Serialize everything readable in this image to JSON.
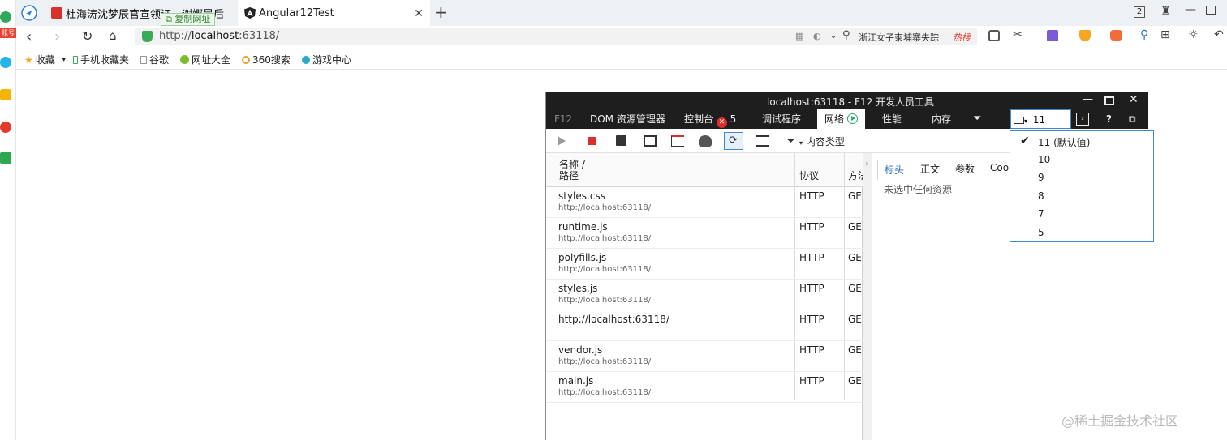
{
  "browser": {
    "tabs": [
      {
        "title": "杜海涛沈梦辰官宣领证，谢娜晨后"
      },
      {
        "title": "Angular12Test"
      }
    ],
    "copy_tooltip": "复制网址",
    "address": {
      "scheme": "http://",
      "host": "localhost",
      "rest": ":63118/"
    },
    "search_text": "浙江女子柬埔寨失踪",
    "hot_badge": "热搜",
    "tab_count": "2",
    "left_badge": "账号",
    "bookmarks": [
      "收藏",
      "手机收藏夹",
      "谷歌",
      "网址大全",
      "360搜索",
      "游戏中心"
    ]
  },
  "devtools": {
    "title": "localhost:63118 - F12 开发人员工具",
    "tabs": [
      "F12",
      "DOM 资源管理器",
      "控制台",
      "调试程序",
      "网络",
      "性能",
      "内存"
    ],
    "console_errors": "5",
    "emulation_mode": "11",
    "toolbar_filter_label": "内容类型",
    "grid_headers": {
      "name": "名称 /",
      "path": "路径",
      "protocol": "协议",
      "method": "方法"
    },
    "rows": [
      {
        "name": "styles.css",
        "url": "http://localhost:63118/",
        "protocol": "HTTP",
        "method": "GE"
      },
      {
        "name": "runtime.js",
        "url": "http://localhost:63118/",
        "protocol": "HTTP",
        "method": "GE"
      },
      {
        "name": "polyfills.js",
        "url": "http://localhost:63118/",
        "protocol": "HTTP",
        "method": "GE"
      },
      {
        "name": "styles.js",
        "url": "http://localhost:63118/",
        "protocol": "HTTP",
        "method": "GE"
      },
      {
        "name": "http://localhost:63118/",
        "url": "",
        "protocol": "HTTP",
        "method": "GE"
      },
      {
        "name": "vendor.js",
        "url": "http://localhost:63118/",
        "protocol": "HTTP",
        "method": "GE"
      },
      {
        "name": "main.js",
        "url": "http://localhost:63118/",
        "protocol": "HTTP",
        "method": "GE"
      }
    ],
    "detail_tabs": [
      "标头",
      "正文",
      "参数",
      "Cook"
    ],
    "detail_empty": "未选中任何资源"
  },
  "doc_mode_menu": {
    "items": [
      "11 (默认值)",
      "10",
      "9",
      "8",
      "7",
      "5"
    ],
    "selected_index": 0
  },
  "watermark": "@稀土掘金技术社区",
  "colors": {
    "accent": "#3c88d0",
    "devtools_dark": "#1e1e1e",
    "error_red": "#d9302c",
    "secure_green": "#3aab58"
  }
}
